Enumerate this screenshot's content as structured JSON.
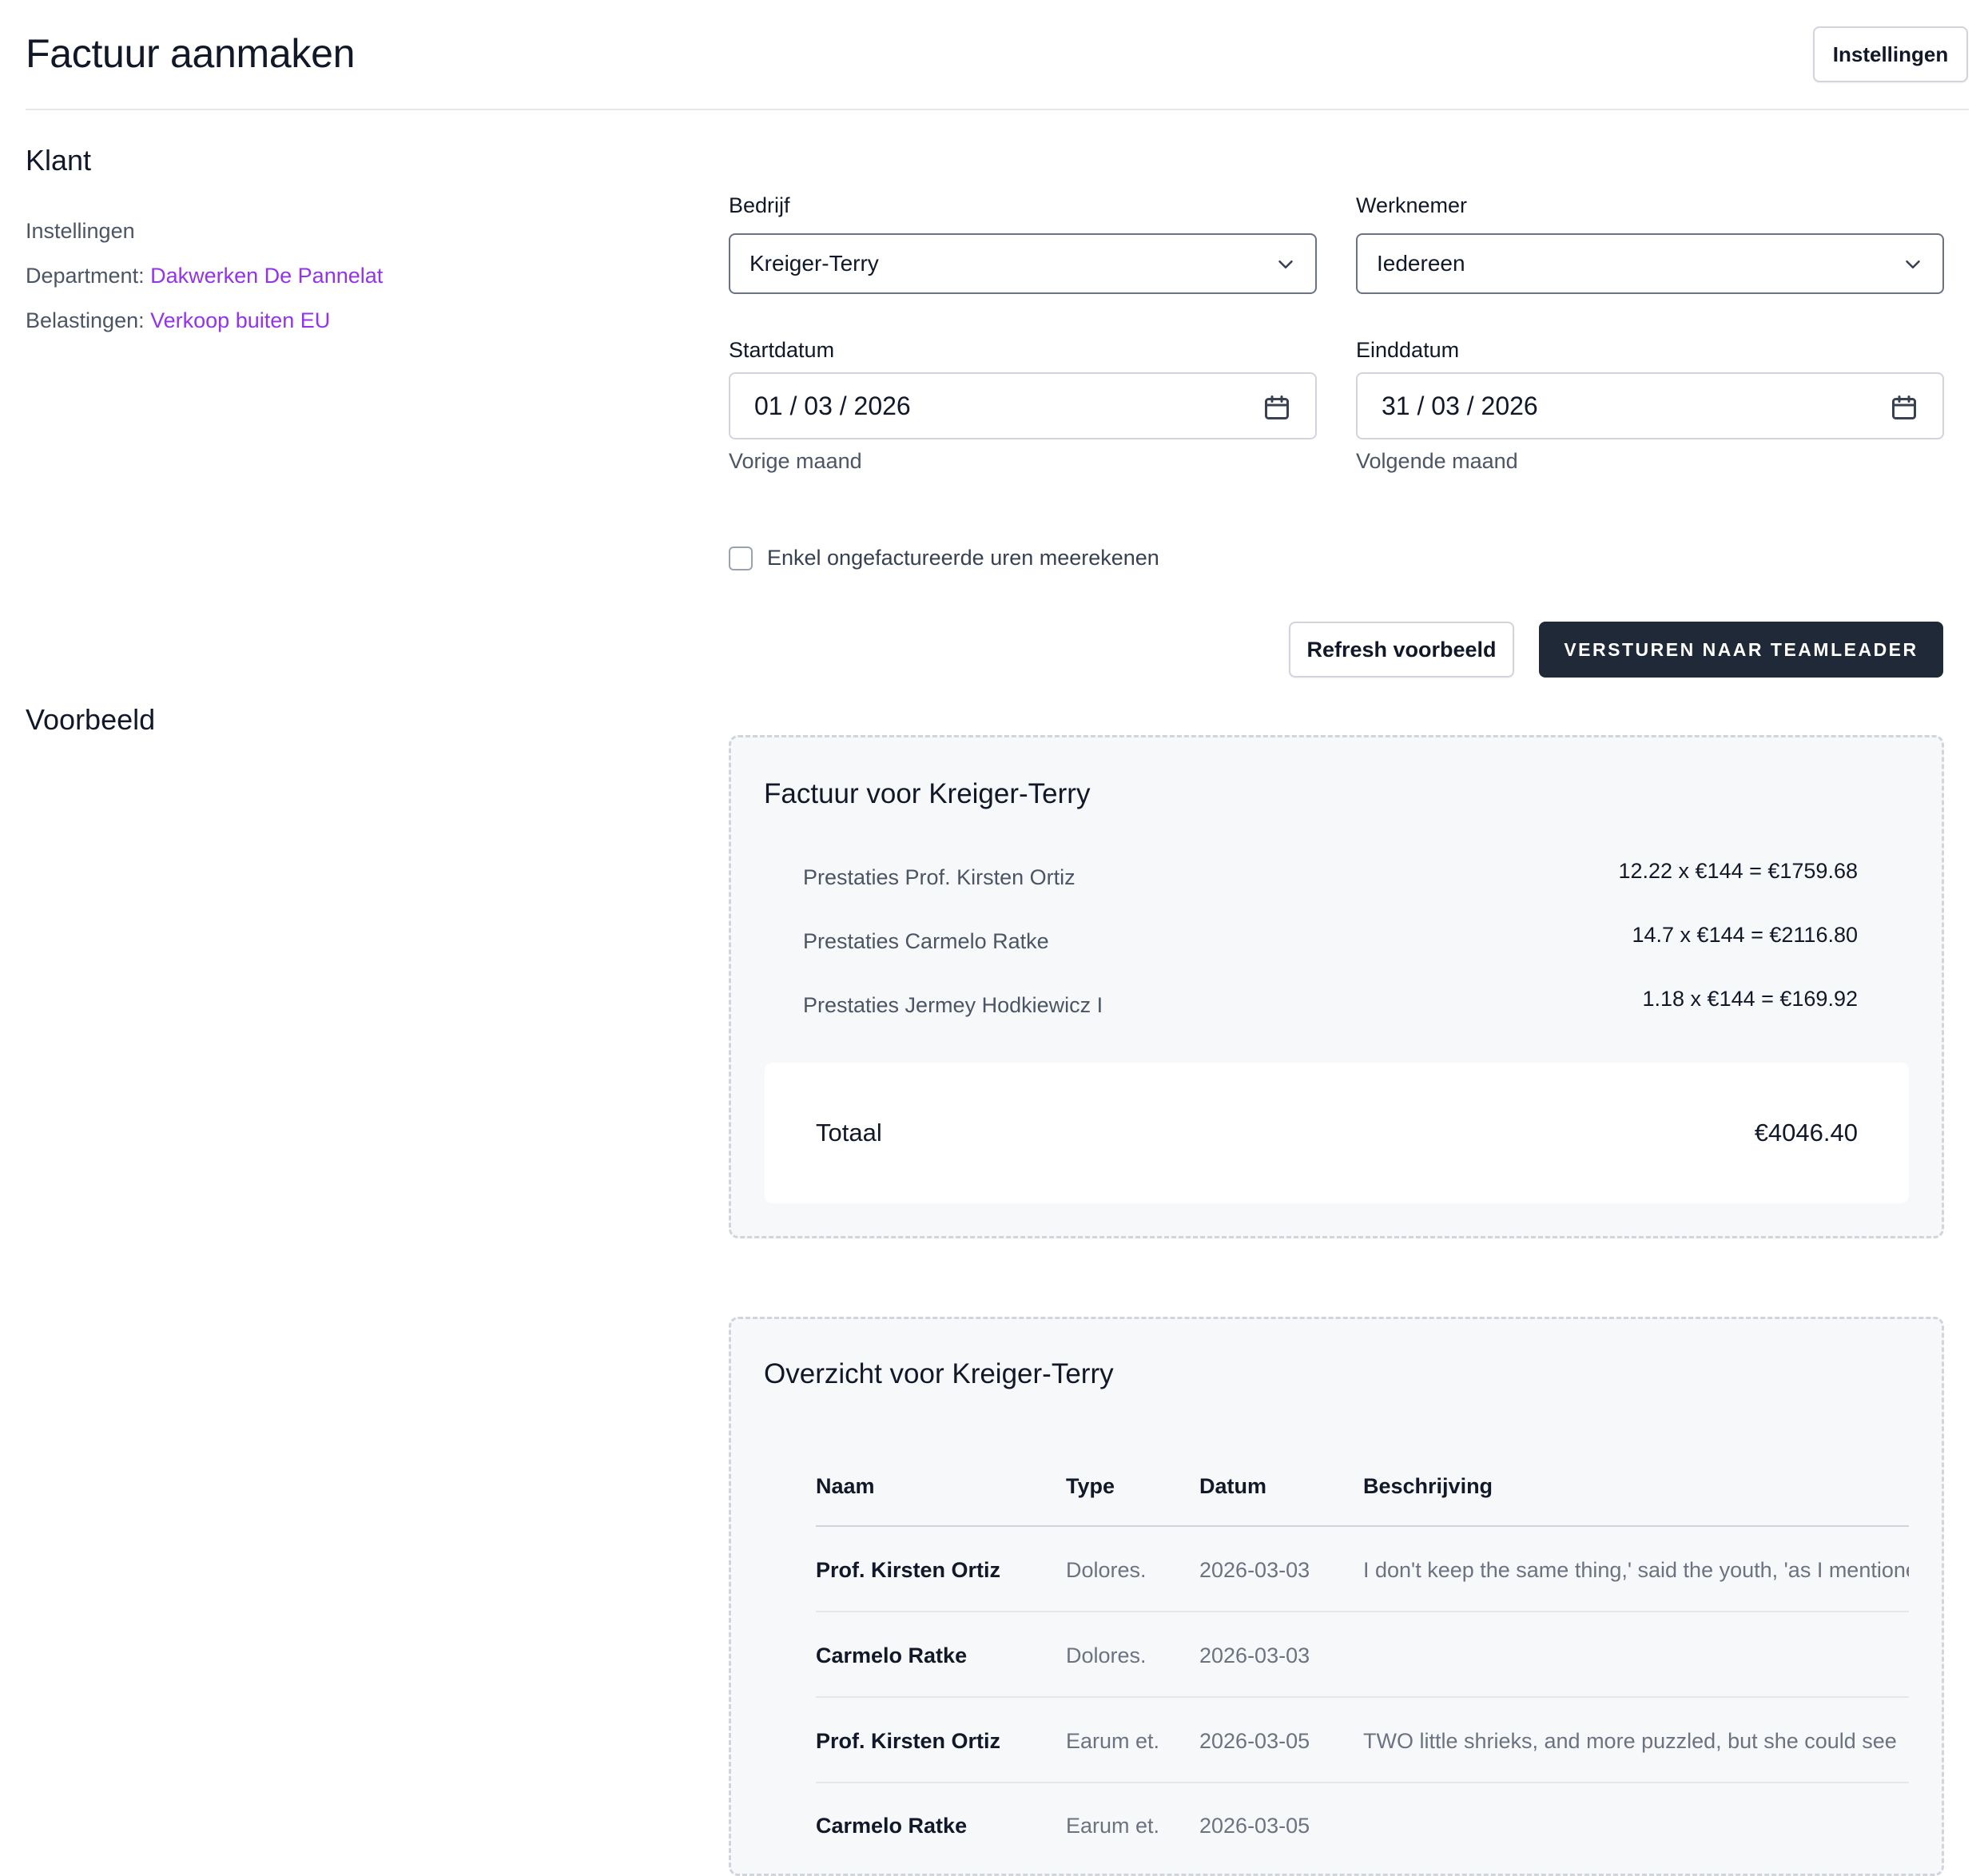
{
  "header": {
    "title": "Factuur aanmaken",
    "settings_button": "Instellingen"
  },
  "klant": {
    "title": "Klant",
    "settings_text": "Instellingen",
    "department_label": "Department:",
    "department_value": "Dakwerken De Pannelat",
    "tax_label": "Belastingen:",
    "tax_value": "Verkoop buiten EU"
  },
  "form": {
    "company_label": "Bedrijf",
    "company_value": "Kreiger-Terry",
    "employee_label": "Werknemer",
    "employee_value": "Iedereen",
    "start_label": "Startdatum",
    "start_value": "01 / 03 / 2026",
    "start_hint": "Vorige maand",
    "end_label": "Einddatum",
    "end_value": "31 / 03 / 2026",
    "end_hint": "Volgende maand",
    "checkbox_label": "Enkel ongefactureerde uren meerekenen",
    "refresh_button": "Refresh voorbeeld",
    "send_button": "VERSTUREN NAAR TEAMLEADER"
  },
  "preview": {
    "title": "Voorbeeld",
    "invoice": {
      "title": "Factuur voor Kreiger-Terry",
      "lines": [
        {
          "label": "Prestaties Prof. Kirsten Ortiz",
          "amount": "12.22 x €144 = €1759.68"
        },
        {
          "label": "Prestaties Carmelo Ratke",
          "amount": "14.7 x €144 = €2116.80"
        },
        {
          "label": "Prestaties Jermey Hodkiewicz I",
          "amount": "1.18 x €144 = €169.92"
        }
      ],
      "total_label": "Totaal",
      "total_value": "€4046.40"
    },
    "overview": {
      "title": "Overzicht voor Kreiger-Terry",
      "columns": [
        "Naam",
        "Type",
        "Datum",
        "Beschrijving"
      ],
      "rows": [
        {
          "name": "Prof. Kirsten Ortiz",
          "type": "Dolores.",
          "date": "2026-03-03",
          "description": "I don't keep the same thing,' said the youth, 'as I mentioned before"
        },
        {
          "name": "Carmelo Ratke",
          "type": "Dolores.",
          "date": "2026-03-03",
          "description": ""
        },
        {
          "name": "Prof. Kirsten Ortiz",
          "type": "Earum et.",
          "date": "2026-03-05",
          "description": "TWO little shrieks, and more puzzled, but she could see"
        },
        {
          "name": "Carmelo Ratke",
          "type": "Earum et.",
          "date": "2026-03-05",
          "description": ""
        }
      ]
    }
  },
  "colors": {
    "accent_link": "#9333ea",
    "primary_button": "#1f2937",
    "card_background": "#f7f8fa"
  }
}
